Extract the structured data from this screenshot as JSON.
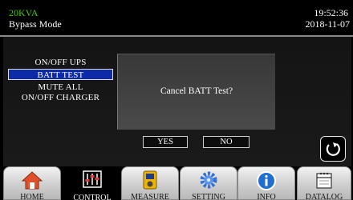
{
  "header": {
    "capacity": "20KVA",
    "mode": "Bypass Mode",
    "time": "19:52:36",
    "date": "2018-11-07"
  },
  "menu": {
    "items": [
      {
        "label": "ON/OFF  UPS",
        "selected": false
      },
      {
        "label": "BATT TEST",
        "selected": true
      },
      {
        "label": "MUTE ALL",
        "selected": false
      },
      {
        "label": "ON/OFF  CHARGER",
        "selected": false
      }
    ]
  },
  "dialog": {
    "message": "Cancel BATT Test?",
    "yes_label": "YES",
    "no_label": "NO"
  },
  "nav": {
    "tabs": [
      {
        "label": "HOME",
        "icon": "home-icon",
        "active": false
      },
      {
        "label": "CONTROL",
        "icon": "sliders-icon",
        "active": true
      },
      {
        "label": "MEASURE",
        "icon": "meter-icon",
        "active": false
      },
      {
        "label": "SETTING",
        "icon": "gear-icon",
        "active": false
      },
      {
        "label": "INFO",
        "icon": "info-icon",
        "active": false
      },
      {
        "label": "DATALOG",
        "icon": "calendar-icon",
        "active": false
      }
    ]
  },
  "colors": {
    "capacity_text": "#41c800",
    "selected_item": "#0d2aa8",
    "home_icon": "#e0502a",
    "gear_icon": "#2f6fd6",
    "info_icon": "#1e6fd0"
  }
}
